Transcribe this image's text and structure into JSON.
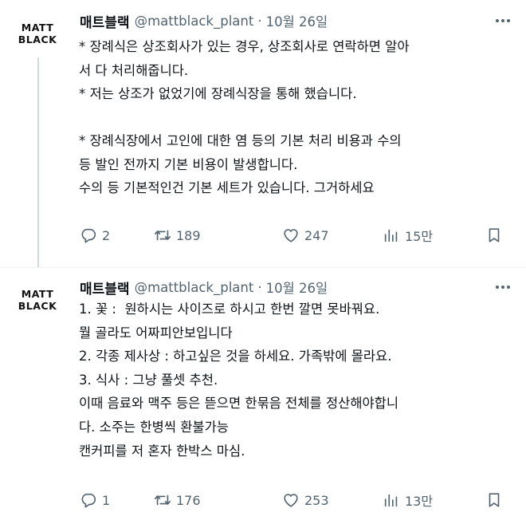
{
  "tweets": [
    {
      "avatar_text": [
        "MATT",
        "BLACK"
      ],
      "display_name": "매트블랙",
      "handle": "@mattblack_plant",
      "separator": "·",
      "date": "10월 26일",
      "lines": [
        "* 장례식은 상조회사가 있는 경우, 상조회사로 연락하면 알아",
        "서 다 처리해줍니다.",
        "* 저는 상조가 없었기에 장례식장을 통해 했습니다.",
        "",
        "* 장례식장에서 고인에 대한 염 등의 기본 처리 비용과 수의",
        "등 발인 전까지 기본 비용이 발생합니다.",
        "수의 등 기본적인건 기본 세트가 있습니다. 그거하세요"
      ],
      "stats": {
        "replies": "2",
        "retweets": "189",
        "likes": "247",
        "views": "15만"
      }
    },
    {
      "avatar_text": [
        "MATT",
        "BLACK"
      ],
      "display_name": "매트블랙",
      "handle": "@mattblack_plant",
      "separator": "·",
      "date": "10월 26일",
      "lines": [
        "1. 꽃 :  원하시는 사이즈로 하시고 한번 깔면 못바꿔요.",
        "뭘 골라도 어짜피안보입니다",
        "2. 각종 제사상 : 하고싶은 것을 하세요. 가족밖에 몰라요.",
        "3. 식사 : 그냥 풀셋 추천.",
        "이때 음료와 맥주 등은 뜯으면 한묶음 전체를 정산해야합니",
        "다. 소주는 한병씩 환불가능",
        "캔커피를 저 혼자 한박스 마심."
      ],
      "stats": {
        "replies": "1",
        "retweets": "176",
        "likes": "253",
        "views": "13만"
      }
    }
  ]
}
